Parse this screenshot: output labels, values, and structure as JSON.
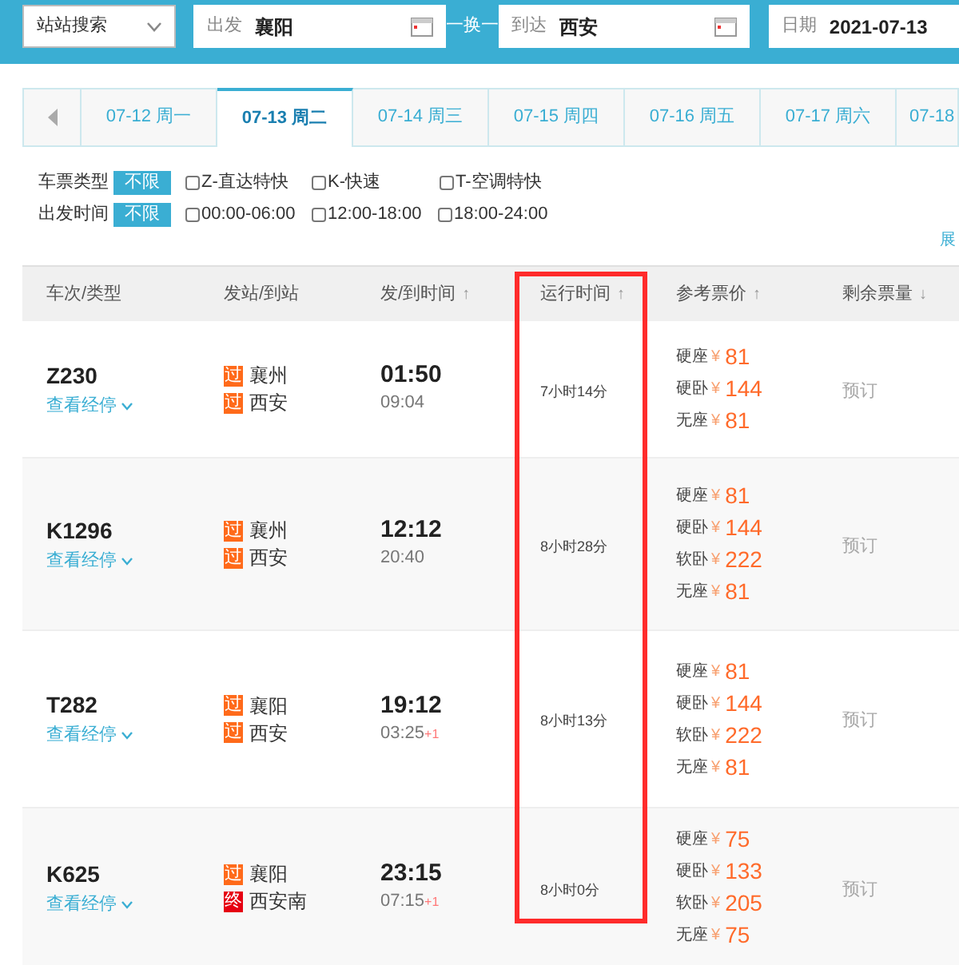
{
  "search_bar": {
    "mode_select": "站站搜索",
    "from": {
      "label": "出发",
      "value": "襄阳"
    },
    "swap_label": "一换一",
    "to": {
      "label": "到达",
      "value": "西安"
    },
    "date": {
      "label": "日期",
      "value": "2021-07-13"
    }
  },
  "date_tabs": [
    {
      "label": "07-12 周一",
      "selected": false
    },
    {
      "label": "07-13 周二",
      "selected": true
    },
    {
      "label": "07-14 周三",
      "selected": false
    },
    {
      "label": "07-15 周四",
      "selected": false
    },
    {
      "label": "07-16 周五",
      "selected": false
    },
    {
      "label": "07-17 周六",
      "selected": false
    },
    {
      "label": "07-18",
      "selected": false
    }
  ],
  "filters": [
    {
      "label": "车票类型",
      "all": "不限",
      "options": [
        {
          "label": "Z-直达特快",
          "checked": false
        },
        {
          "label": "K-快速",
          "checked": false
        },
        {
          "label": "T-空调特快",
          "checked": false
        }
      ]
    },
    {
      "label": "出发时间",
      "all": "不限",
      "options": [
        {
          "label": "00:00-06:00",
          "checked": false
        },
        {
          "label": "12:00-18:00",
          "checked": false
        },
        {
          "label": "18:00-24:00",
          "checked": false
        }
      ]
    }
  ],
  "expand_link": "展",
  "table": {
    "columns": [
      {
        "label": "车次/类型",
        "highlighted": false
      },
      {
        "label": "发站/到站",
        "highlighted": false
      },
      {
        "label": "发/到时间",
        "sort_arrow": "↑",
        "highlighted": false
      },
      {
        "label": "运行时间",
        "sort_arrow": "↑",
        "highlighted": true
      },
      {
        "label": "参考票价",
        "sort_arrow": "↑",
        "highlighted": false
      },
      {
        "label": "剩余票量",
        "sort_arrow": "↓",
        "highlighted": false
      }
    ],
    "rows": [
      {
        "train": "Z230",
        "stops_link": "查看经停",
        "from": {
          "badge": "过",
          "kind": "pass",
          "name": "襄州"
        },
        "to": {
          "badge": "过",
          "kind": "pass",
          "name": "西安"
        },
        "depart": "01:50",
        "arrive": "09:04",
        "next_day": "",
        "duration": "7小时14分",
        "prices": [
          {
            "seat": "硬座",
            "currency": "¥",
            "price": "81"
          },
          {
            "seat": "硬卧",
            "currency": "¥",
            "price": "144"
          },
          {
            "seat": "无座",
            "currency": "¥",
            "price": "81"
          }
        ],
        "book": "预订"
      },
      {
        "train": "K1296",
        "stops_link": "查看经停",
        "from": {
          "badge": "过",
          "kind": "pass",
          "name": "襄州"
        },
        "to": {
          "badge": "过",
          "kind": "pass",
          "name": "西安"
        },
        "depart": "12:12",
        "arrive": "20:40",
        "next_day": "",
        "duration": "8小时28分",
        "prices": [
          {
            "seat": "硬座",
            "currency": "¥",
            "price": "81"
          },
          {
            "seat": "硬卧",
            "currency": "¥",
            "price": "144"
          },
          {
            "seat": "软卧",
            "currency": "¥",
            "price": "222"
          },
          {
            "seat": "无座",
            "currency": "¥",
            "price": "81"
          }
        ],
        "book": "预订"
      },
      {
        "train": "T282",
        "stops_link": "查看经停",
        "from": {
          "badge": "过",
          "kind": "pass",
          "name": "襄阳"
        },
        "to": {
          "badge": "过",
          "kind": "pass",
          "name": "西安"
        },
        "depart": "19:12",
        "arrive": "03:25",
        "next_day": "+1",
        "duration": "8小时13分",
        "prices": [
          {
            "seat": "硬座",
            "currency": "¥",
            "price": "81"
          },
          {
            "seat": "硬卧",
            "currency": "¥",
            "price": "144"
          },
          {
            "seat": "软卧",
            "currency": "¥",
            "price": "222"
          },
          {
            "seat": "无座",
            "currency": "¥",
            "price": "81"
          }
        ],
        "book": "预订"
      },
      {
        "train": "K625",
        "stops_link": "查看经停",
        "from": {
          "badge": "过",
          "kind": "pass",
          "name": "襄阳"
        },
        "to": {
          "badge": "终",
          "kind": "terminal",
          "name": "西安南"
        },
        "depart": "23:15",
        "arrive": "07:15",
        "next_day": "+1",
        "duration": "8小时0分",
        "prices": [
          {
            "seat": "硬座",
            "currency": "¥",
            "price": "75"
          },
          {
            "seat": "硬卧",
            "currency": "¥",
            "price": "133"
          },
          {
            "seat": "软卧",
            "currency": "¥",
            "price": "205"
          },
          {
            "seat": "无座",
            "currency": "¥",
            "price": "75"
          }
        ],
        "book": "预订"
      }
    ]
  }
}
